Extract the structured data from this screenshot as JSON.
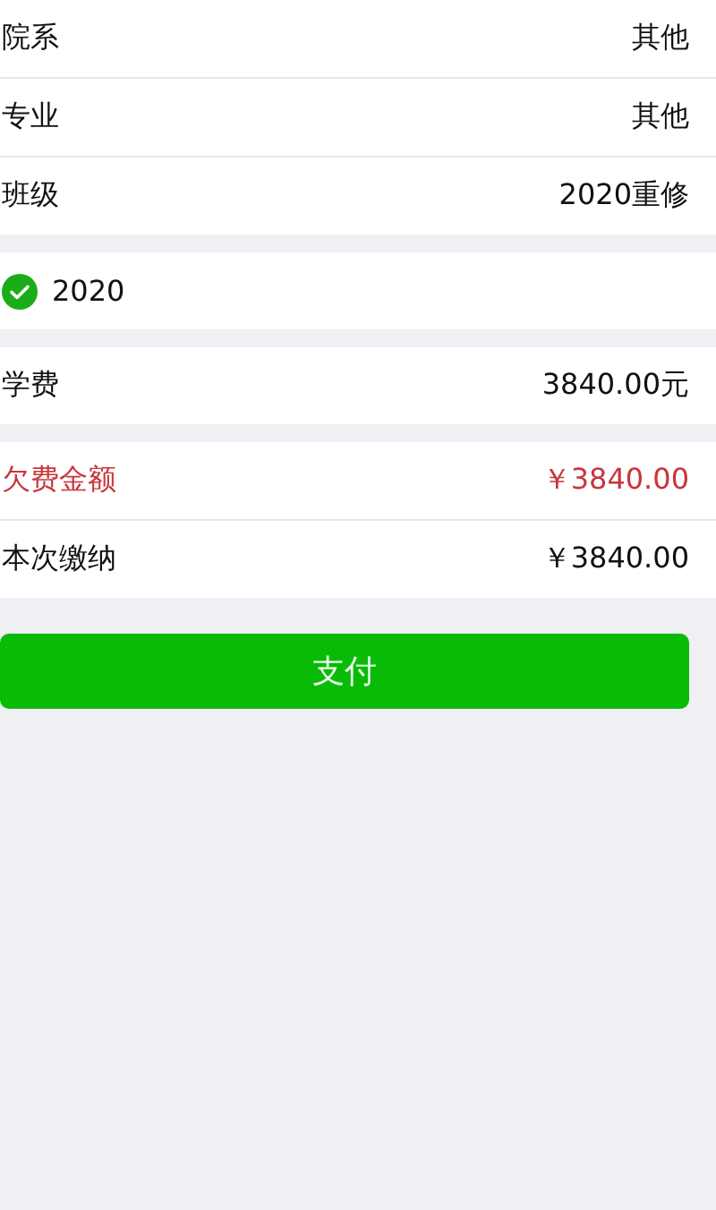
{
  "sections": [
    {
      "rows": [
        {
          "kind": "plain",
          "label": "院系",
          "value": "其他"
        },
        {
          "kind": "plain",
          "label": "专业",
          "value": "其他"
        },
        {
          "kind": "plain",
          "label": "班级",
          "value": "2020重修"
        }
      ]
    },
    {
      "rows": [
        {
          "kind": "check",
          "label": "2020",
          "checked": true
        }
      ]
    },
    {
      "rows": [
        {
          "kind": "plain",
          "label": "学费",
          "value": "3840.00元"
        }
      ]
    },
    {
      "rows": [
        {
          "kind": "warning",
          "label": "欠费金额",
          "value": "￥3840.00"
        },
        {
          "kind": "plain",
          "label": "本次缴纳",
          "value": "￥3840.00"
        }
      ]
    }
  ],
  "pay_button": "支付"
}
